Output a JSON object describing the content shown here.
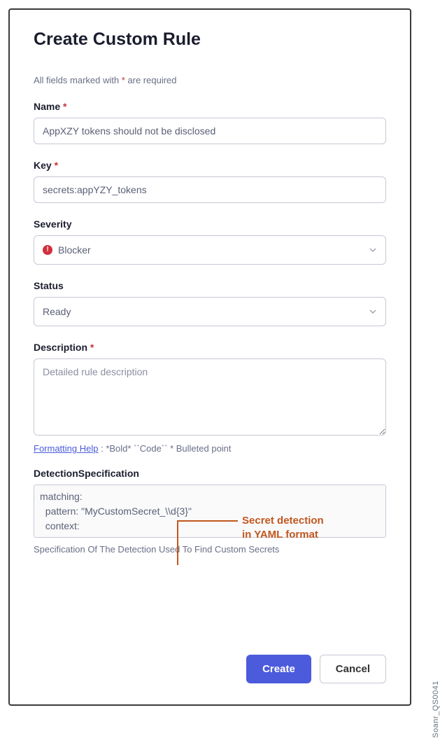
{
  "dialog": {
    "title": "Create Custom Rule",
    "required_note_prefix": "All fields marked with ",
    "required_note_asterisk": "*",
    "required_note_suffix": " are required"
  },
  "fields": {
    "name": {
      "label": "Name",
      "required": "*",
      "value": "AppXZY tokens should not be disclosed"
    },
    "key": {
      "label": "Key",
      "required": "*",
      "value": "secrets:appYZY_tokens"
    },
    "severity": {
      "label": "Severity",
      "value": "Blocker"
    },
    "status": {
      "label": "Status",
      "value": "Ready"
    },
    "description": {
      "label": "Description",
      "required": "*",
      "placeholder": "Detailed rule description"
    },
    "format_help": {
      "link": "Formatting Help",
      "rest": " :  *Bold*  ``Code``  * Bulleted point"
    },
    "detection": {
      "label": "DetectionSpecification",
      "value": "matching:\n  pattern: \"MyCustomSecret_\\\\d{3}\"\n  context:\n    matchEither:",
      "help": "Specification Of The Detection Used To Find Custom Secrets"
    }
  },
  "annotation": {
    "line1": "Secret detection",
    "line2": "in YAML format"
  },
  "buttons": {
    "create": "Create",
    "cancel": "Cancel"
  },
  "side_label": "Soanr_QS0041"
}
